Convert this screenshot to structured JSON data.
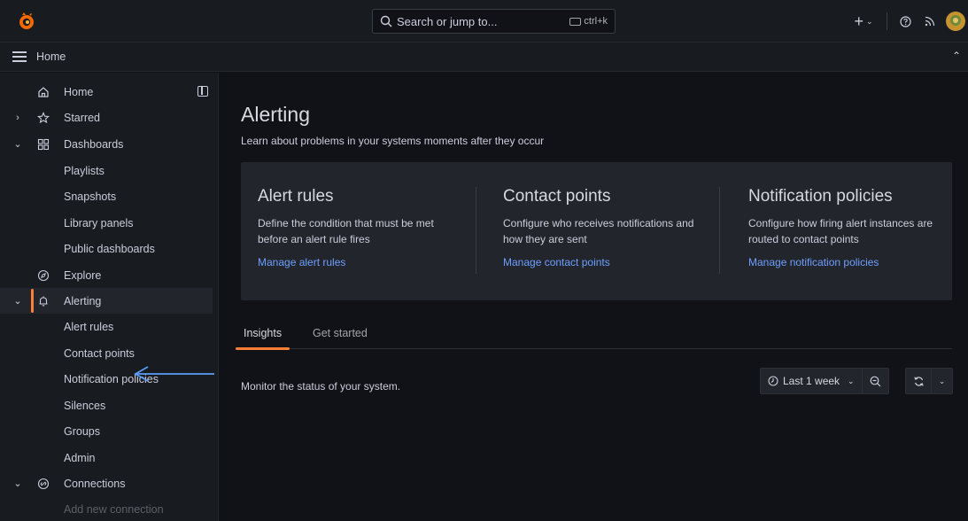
{
  "search": {
    "placeholder": "Search or jump to...",
    "shortcut": "ctrl+k"
  },
  "topbar": {
    "new_icon": "plus-icon",
    "help_icon": "help-icon",
    "news_icon": "rss-icon"
  },
  "breadcrumb": {
    "home": "Home"
  },
  "sidebar": {
    "items": [
      {
        "label": "Home",
        "icon": "home-icon"
      },
      {
        "label": "Starred",
        "icon": "star-icon",
        "caret": "›"
      },
      {
        "label": "Dashboards",
        "icon": "apps-icon",
        "caret": "⌄"
      },
      {
        "label": "Playlists"
      },
      {
        "label": "Snapshots"
      },
      {
        "label": "Library panels"
      },
      {
        "label": "Public dashboards"
      },
      {
        "label": "Explore",
        "icon": "compass-icon"
      },
      {
        "label": "Alerting",
        "icon": "bell-icon",
        "caret": "⌄"
      },
      {
        "label": "Alert rules"
      },
      {
        "label": "Contact points"
      },
      {
        "label": "Notification policies"
      },
      {
        "label": "Silences"
      },
      {
        "label": "Groups"
      },
      {
        "label": "Admin"
      },
      {
        "label": "Connections",
        "icon": "connections-icon",
        "caret": "⌄"
      },
      {
        "label": "Add new connection"
      }
    ]
  },
  "main": {
    "title": "Alerting",
    "subtitle": "Learn about problems in your systems moments after they occur",
    "cards": [
      {
        "title": "Alert rules",
        "desc": "Define the condition that must be met before an alert rule fires",
        "link": "Manage alert rules"
      },
      {
        "title": "Contact points",
        "desc": "Configure who receives notifications and how they are sent",
        "link": "Manage contact points"
      },
      {
        "title": "Notification policies",
        "desc": "Configure how firing alert instances are routed to contact points",
        "link": "Manage notification policies"
      }
    ],
    "tabs": [
      {
        "label": "Insights"
      },
      {
        "label": "Get started"
      }
    ],
    "status_text": "Monitor the status of your system.",
    "time_range": "Last 1 week"
  },
  "colors": {
    "accent": "#ff7f36",
    "link": "#6e9fff",
    "background": "#111217",
    "panel": "#22252b",
    "annotation_arrow": "#5a9cf8"
  }
}
